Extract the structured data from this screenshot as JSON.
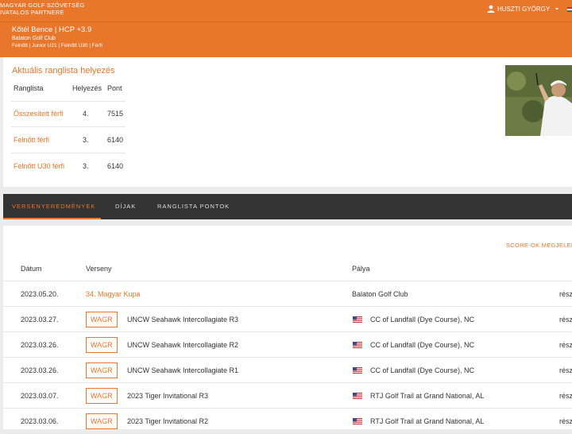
{
  "header": {
    "brand_line1": "MAGYAR GOLF SZÖVETSÉG",
    "brand_line2": "IVATALOS PARTNERE",
    "user_name": "HUSZTI GYÖRGY"
  },
  "profile": {
    "name": "Kőtél Bence | HCP +3.9",
    "club": "Balaton Golf Club",
    "categories": "Felnőtt | Junior U21 | Felnőtt U30 | Férfi"
  },
  "ranking": {
    "title": "Aktuális ranglista helyezés",
    "headers": [
      "Ranglista",
      "Helyezés",
      "Pont"
    ],
    "rows": [
      {
        "name": "Összesített férfi",
        "place": "4.",
        "points": "7515"
      },
      {
        "name": "Felnőtt férfi",
        "place": "3.",
        "points": "6140"
      },
      {
        "name": "Felnőtt U30 férfi",
        "place": "3.",
        "points": "6140"
      }
    ]
  },
  "tabs": [
    "VERSENYEREDMÉNYEK",
    "DÍJAK",
    "RANGLISTA PONTOK"
  ],
  "results": {
    "scores_link": "SCORE-OK MEGJELEN",
    "headers": {
      "date": "Dátum",
      "event": "Verseny",
      "course": "Pálya"
    },
    "badge": "WAGR",
    "more_text": "rész",
    "rows": [
      {
        "date": "2023.05.20.",
        "event": "34. Magyar Kupa",
        "course": "Balaton Golf Club"
      },
      {
        "date": "2023.03.27.",
        "event": "UNCW Seahawk Intercollagiate R3",
        "course": "CC of Landfall (Dye Course), NC"
      },
      {
        "date": "2023.03.26.",
        "event": "UNCW Seahawk Intercollagiate R2",
        "course": "CC of Landfall (Dye Course), NC"
      },
      {
        "date": "2023.03.26.",
        "event": "UNCW Seahawk Intercollagiate R1",
        "course": "CC of Landfall (Dye Course), NC"
      },
      {
        "date": "2023.03.07.",
        "event": "2023 Tiger Invitational R3",
        "course": "RTJ Golf Trail at Grand National, AL"
      },
      {
        "date": "2023.03.06.",
        "event": "2023 Tiger Invitational R2",
        "course": "RTJ Golf Trail at Grand National, AL"
      }
    ]
  },
  "colors": {
    "accent": "#e8762b",
    "tabbar": "#333333"
  }
}
